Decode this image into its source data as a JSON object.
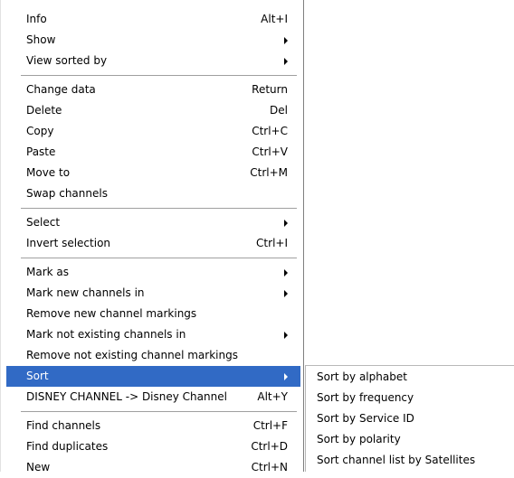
{
  "main_menu": {
    "info": {
      "label": "Info",
      "shortcut": "Alt+I"
    },
    "show": {
      "label": "Show"
    },
    "view_sorted_by": {
      "label": "View sorted by"
    },
    "change_data": {
      "label": "Change data",
      "shortcut": "Return"
    },
    "delete": {
      "label": "Delete",
      "shortcut": "Del"
    },
    "copy": {
      "label": "Copy",
      "shortcut": "Ctrl+C"
    },
    "paste": {
      "label": "Paste",
      "shortcut": "Ctrl+V"
    },
    "move_to": {
      "label": "Move to",
      "shortcut": "Ctrl+M"
    },
    "swap_channels": {
      "label": "Swap channels"
    },
    "select": {
      "label": "Select"
    },
    "invert_selection": {
      "label": "Invert selection",
      "shortcut": "Ctrl+I"
    },
    "mark_as": {
      "label": "Mark as"
    },
    "mark_new_channels_in": {
      "label": "Mark new channels in"
    },
    "remove_new_channel_markings": {
      "label": "Remove new channel markings"
    },
    "mark_not_existing_channels_in": {
      "label": "Mark not existing channels in"
    },
    "remove_not_existing_channel_markings": {
      "label": "Remove not existing channel markings"
    },
    "sort": {
      "label": "Sort"
    },
    "rename_channel": {
      "label": "DISNEY CHANNEL -> Disney Channel",
      "shortcut": "Alt+Y"
    },
    "find_channels": {
      "label": "Find channels",
      "shortcut": "Ctrl+F"
    },
    "find_duplicates": {
      "label": "Find duplicates",
      "shortcut": "Ctrl+D"
    },
    "new": {
      "label": "New",
      "shortcut": "Ctrl+N"
    }
  },
  "sort_submenu": {
    "items": [
      "Sort by alphabet",
      "Sort by frequency",
      "Sort by Service ID",
      "Sort by polarity",
      "Sort channel list by Satellites"
    ]
  },
  "colors": {
    "highlight": "#316ac5",
    "menu_background": "#ffffff",
    "separator": "#a0a0a0"
  },
  "icons": [
    "submenu-arrow-icon"
  ]
}
